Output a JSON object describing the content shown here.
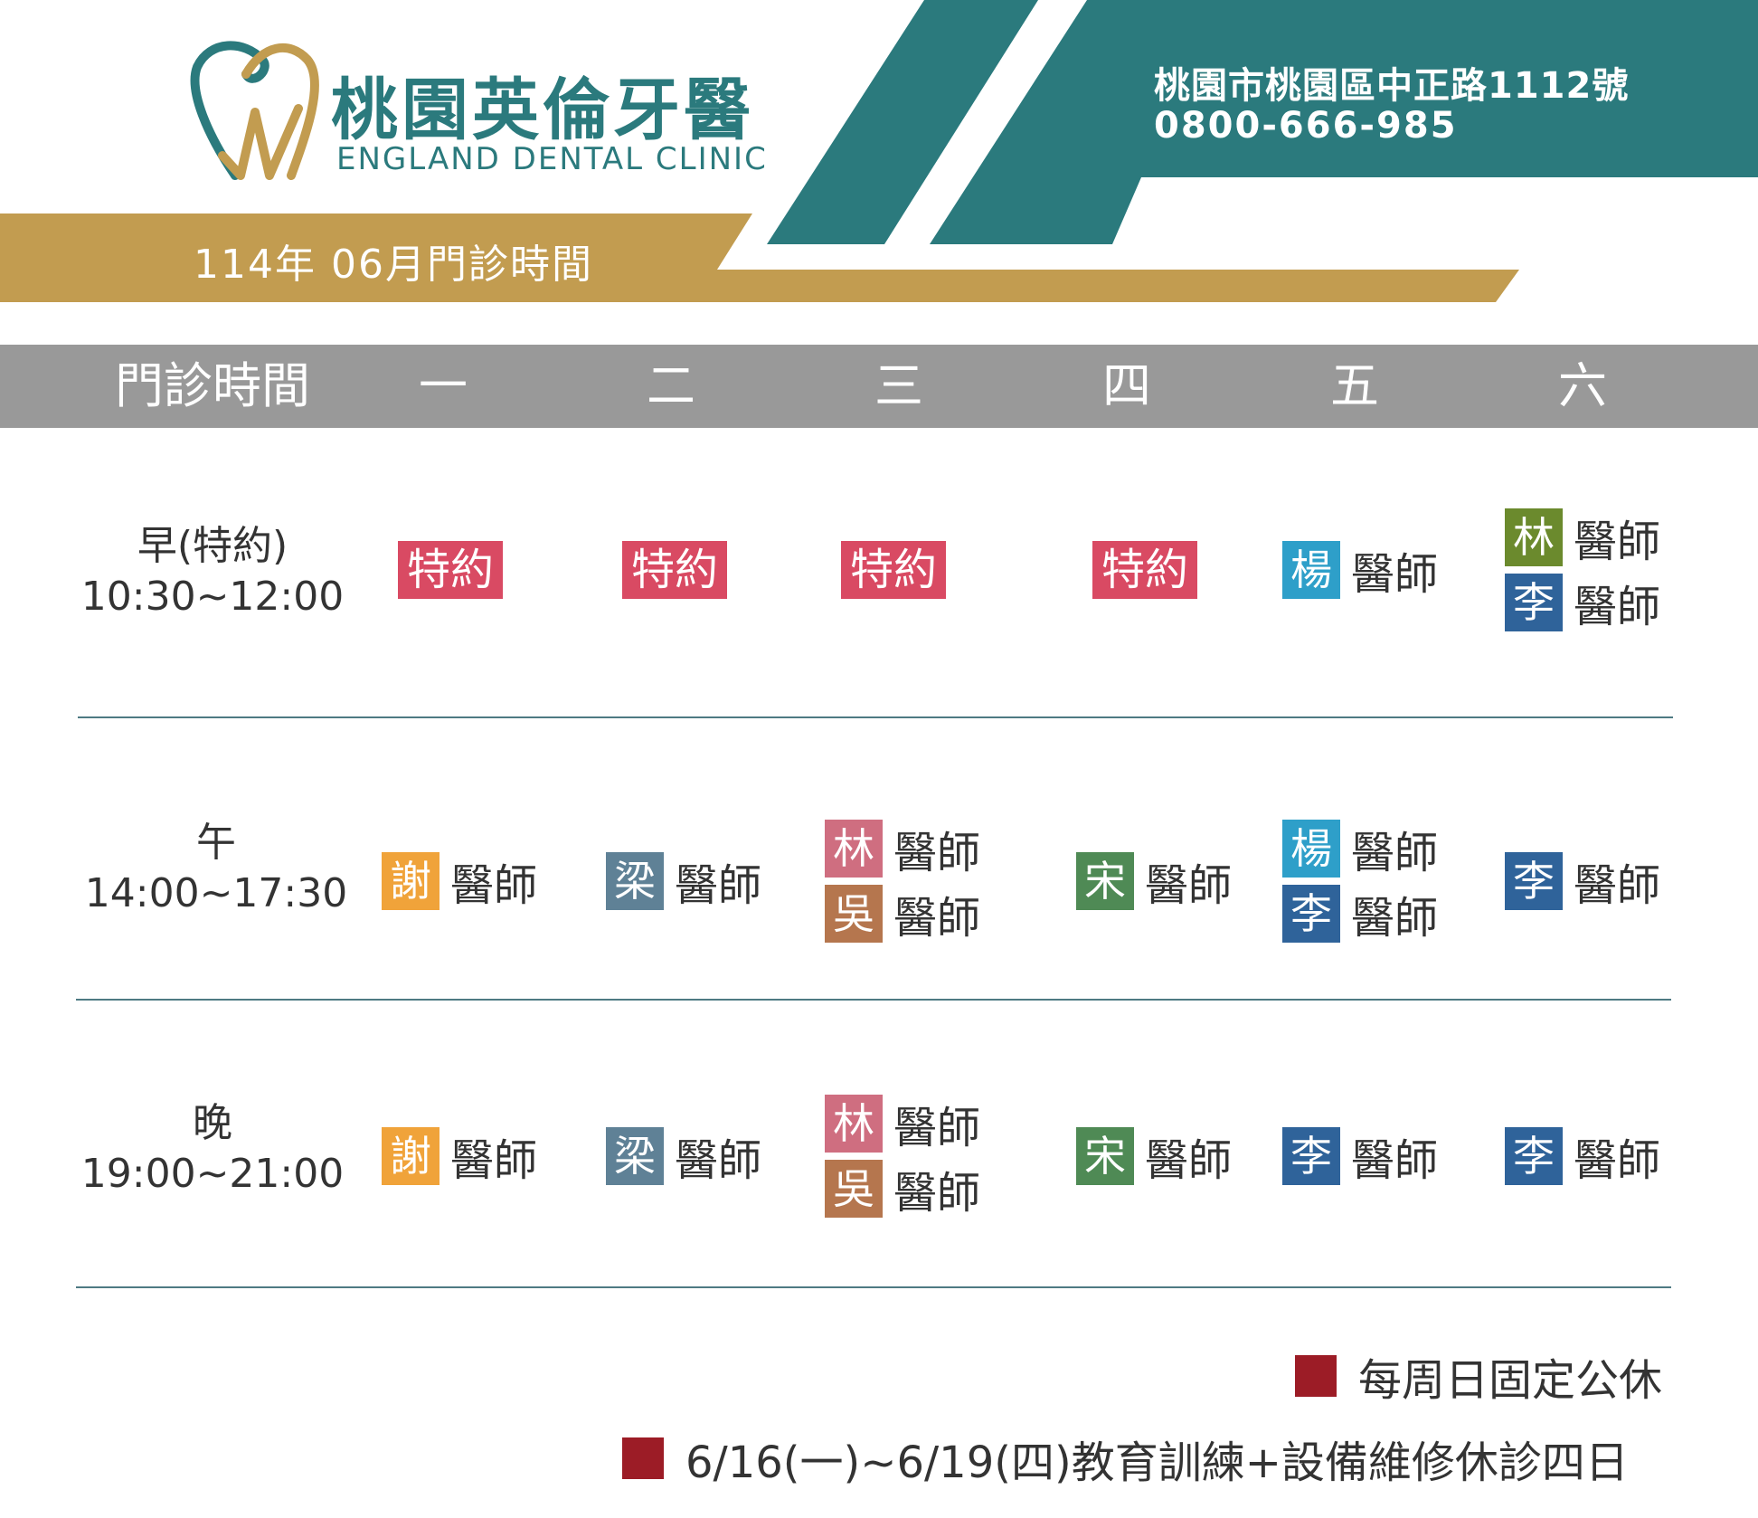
{
  "header": {
    "clinic_name": "桃園英倫牙醫",
    "clinic_name_en": "ENGLAND DENTAL CLINIC",
    "month_title": "114年 06月門診時間",
    "address": "桃園市桃園區中正路1112號",
    "phone": "0800-666-985",
    "colors": {
      "teal": "#2b7a7d",
      "gold": "#c29c50"
    }
  },
  "table": {
    "columns": [
      "門診時間",
      "一",
      "二",
      "三",
      "四",
      "五",
      "六"
    ],
    "rows": [
      {
        "label": "早(特約)",
        "time": "10:30~12:00",
        "cells": [
          {
            "kind": "appt",
            "text": "特約"
          },
          {
            "kind": "appt",
            "text": "特約"
          },
          {
            "kind": "appt",
            "text": "特約"
          },
          {
            "kind": "appt",
            "text": "特約"
          },
          {
            "kind": "docs",
            "docs": [
              {
                "surname": "楊",
                "title": "醫師"
              }
            ]
          },
          {
            "kind": "docs",
            "docs": [
              {
                "surname": "林",
                "title": "醫師"
              },
              {
                "surname": "李",
                "title": "醫師"
              }
            ]
          }
        ]
      },
      {
        "label": "午",
        "time": "14:00~17:30",
        "cells": [
          {
            "kind": "docs",
            "docs": [
              {
                "surname": "謝",
                "title": "醫師"
              }
            ]
          },
          {
            "kind": "docs",
            "docs": [
              {
                "surname": "梁",
                "title": "醫師"
              }
            ]
          },
          {
            "kind": "docs",
            "docs": [
              {
                "surname": "林",
                "title": "醫師"
              },
              {
                "surname": "吳",
                "title": "醫師"
              }
            ]
          },
          {
            "kind": "docs",
            "docs": [
              {
                "surname": "宋",
                "title": "醫師"
              }
            ]
          },
          {
            "kind": "docs",
            "docs": [
              {
                "surname": "楊",
                "title": "醫師"
              },
              {
                "surname": "李",
                "title": "醫師"
              }
            ]
          },
          {
            "kind": "docs",
            "docs": [
              {
                "surname": "李",
                "title": "醫師"
              }
            ]
          }
        ]
      },
      {
        "label": "晚",
        "time": "19:00~21:00",
        "cells": [
          {
            "kind": "docs",
            "docs": [
              {
                "surname": "謝",
                "title": "醫師"
              }
            ]
          },
          {
            "kind": "docs",
            "docs": [
              {
                "surname": "梁",
                "title": "醫師"
              }
            ]
          },
          {
            "kind": "docs",
            "docs": [
              {
                "surname": "林",
                "title": "醫師"
              },
              {
                "surname": "吳",
                "title": "醫師"
              }
            ]
          },
          {
            "kind": "docs",
            "docs": [
              {
                "surname": "宋",
                "title": "醫師"
              }
            ]
          },
          {
            "kind": "docs",
            "docs": [
              {
                "surname": "李",
                "title": "醫師"
              }
            ]
          },
          {
            "kind": "docs",
            "docs": [
              {
                "surname": "李",
                "title": "醫師"
              }
            ]
          }
        ]
      }
    ]
  },
  "doctor_colors": {
    "楊": "#2e9fc9",
    "林": "#6b8a2d",
    "李": "#2f639a",
    "謝": "#f0a33a",
    "梁": "#5f8196",
    "宋": "#4f8a55",
    "吳": "#b5764e",
    "appt": "#d94a63",
    "林_weekday": "#cf6e80"
  },
  "notes": [
    "每周日固定公休",
    "6/16(一)~6/19(四)教育訓練+設備維修休診四日"
  ]
}
